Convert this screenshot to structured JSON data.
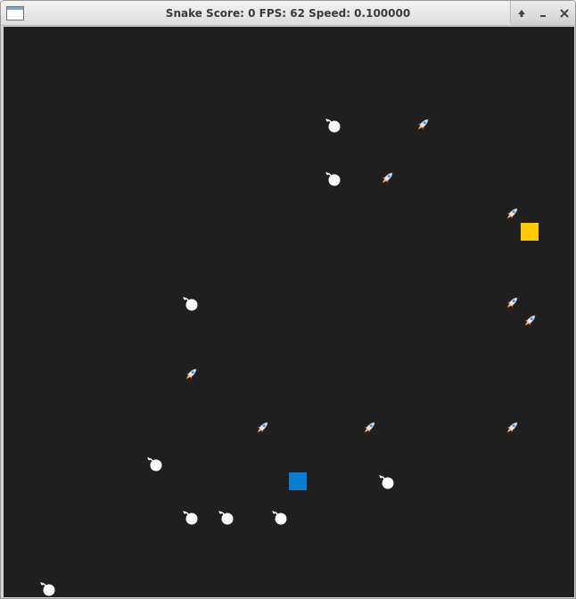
{
  "window": {
    "title": "Snake Score: 0 FPS: 62 Speed: 0.100000",
    "controls": [
      "maximize",
      "minimize",
      "close"
    ]
  },
  "game": {
    "score": 0,
    "fps": 62,
    "speed": 0.1,
    "board_bg": "#1f1f1f",
    "food_color": "#ffcc00",
    "snake_color": "#0a7ed0",
    "cell_grid": {
      "cols": 32,
      "rows": 32
    },
    "snake_head_cell": [
      16,
      25
    ],
    "food_cell": [
      29,
      11
    ],
    "bombs_cells": [
      [
        18,
        5
      ],
      [
        18,
        8
      ],
      [
        10,
        15
      ],
      [
        8,
        24
      ],
      [
        21,
        25
      ],
      [
        10,
        27
      ],
      [
        12,
        27
      ],
      [
        15,
        27
      ],
      [
        2,
        31
      ]
    ],
    "rockets_cells": [
      [
        23,
        5
      ],
      [
        21,
        8
      ],
      [
        28,
        10
      ],
      [
        28,
        15
      ],
      [
        29,
        16
      ],
      [
        10,
        19
      ],
      [
        14,
        22
      ],
      [
        20,
        22
      ],
      [
        28,
        22
      ]
    ]
  }
}
